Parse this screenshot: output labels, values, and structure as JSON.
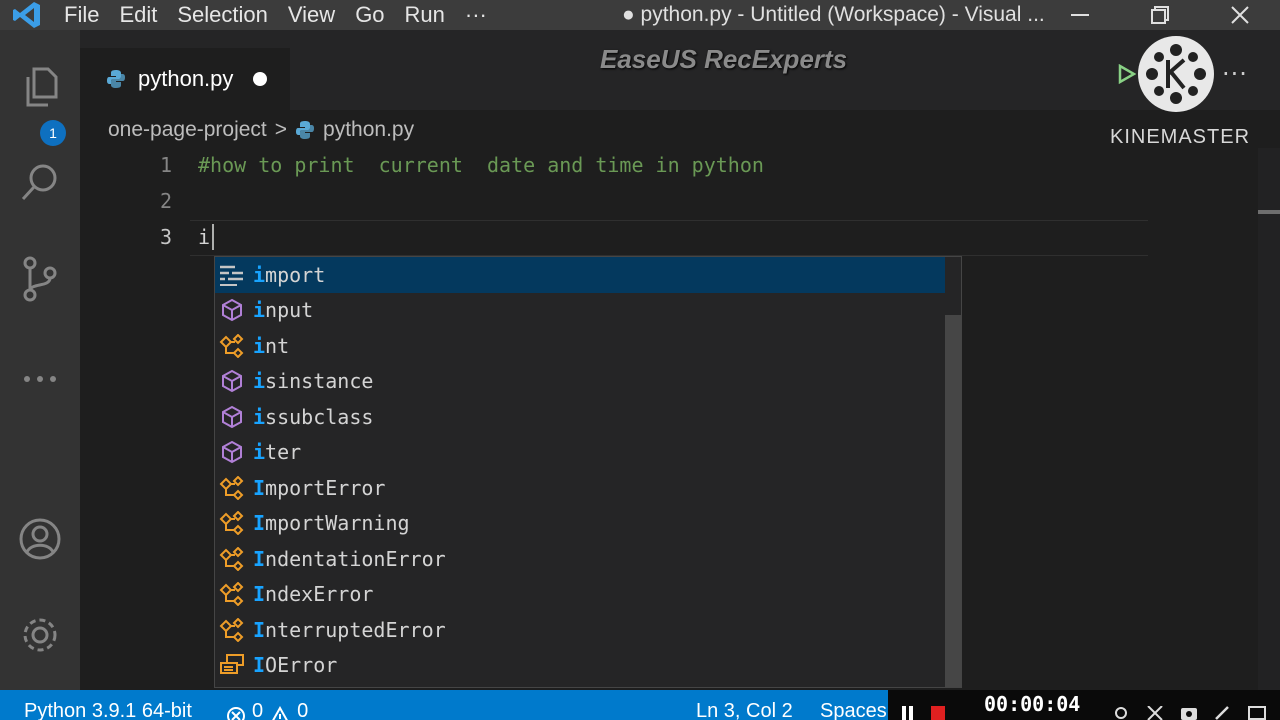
{
  "titlebar": {
    "menu": [
      "File",
      "Edit",
      "Selection",
      "View",
      "Go",
      "Run",
      "···"
    ],
    "window_title": "● python.py - Untitled (Workspace) - Visual ..."
  },
  "activitybar": {
    "explorer_badge": "1"
  },
  "tabs": [
    {
      "label": "python.py",
      "modified": true
    }
  ],
  "overlay": {
    "watermark": "EaseUS RecExperts",
    "kinemaster_text": "KINEMASTER",
    "more_actions": "···"
  },
  "breadcrumb": {
    "folder": "one-page-project",
    "separator": ">",
    "file": "python.py"
  },
  "editor": {
    "line_numbers": [
      "1",
      "2",
      "3"
    ],
    "lines": [
      "#how to print  current  date and time in python",
      "",
      "i"
    ],
    "active_line": 3
  },
  "suggestions": {
    "typed": "i",
    "items": [
      {
        "prefix": "i",
        "rest": "mport",
        "kind": "keyword-icon",
        "selected": true
      },
      {
        "prefix": "i",
        "rest": "nput",
        "kind": "function-icon"
      },
      {
        "prefix": "i",
        "rest": "nt",
        "kind": "class-icon"
      },
      {
        "prefix": "i",
        "rest": "sinstance",
        "kind": "function-icon"
      },
      {
        "prefix": "i",
        "rest": "ssubclass",
        "kind": "function-icon"
      },
      {
        "prefix": "i",
        "rest": "ter",
        "kind": "function-icon"
      },
      {
        "prefix": "I",
        "rest": "mportError",
        "kind": "class-icon"
      },
      {
        "prefix": "I",
        "rest": "mportWarning",
        "kind": "class-icon"
      },
      {
        "prefix": "I",
        "rest": "ndentationError",
        "kind": "class-icon"
      },
      {
        "prefix": "I",
        "rest": "ndexError",
        "kind": "class-icon"
      },
      {
        "prefix": "I",
        "rest": "nterruptedError",
        "kind": "class-icon"
      },
      {
        "prefix": "I",
        "rest": "OError",
        "kind": "variable-icon"
      }
    ]
  },
  "statusbar": {
    "interpreter": "Python 3.9.1 64-bit",
    "errors": "0",
    "warnings": "0",
    "position": "Ln 3, Col 2",
    "spaces": "Spaces",
    "recording_time": "00:00:04"
  },
  "colors": {
    "statusbar": "#007acc",
    "selection": "#04395e",
    "match_highlight": "#18a3ff",
    "comment": "#6a9955"
  }
}
